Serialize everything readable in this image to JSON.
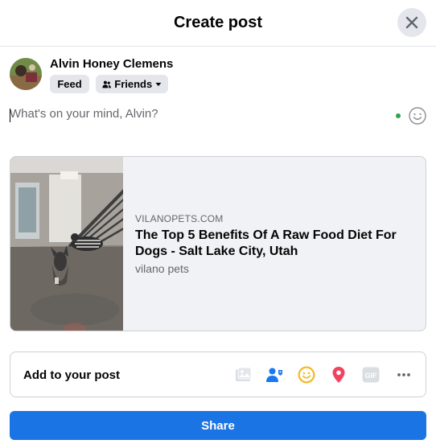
{
  "header": {
    "title": "Create post"
  },
  "user": {
    "name": "Alvin Honey Clemens"
  },
  "audience": {
    "feed_label": "Feed",
    "friends_label": "Friends"
  },
  "composer": {
    "placeholder": "What's on your mind, Alvin?"
  },
  "link_preview": {
    "domain": "VILANOPETS.COM",
    "title": "The Top 5 Benefits Of A Raw Food Diet For Dogs - Salt Lake City, Utah",
    "description": "vilano pets"
  },
  "add_to_post": {
    "label": "Add to your post",
    "icons": [
      "photo-video-icon",
      "tag-people-icon",
      "feeling-activity-icon",
      "check-in-icon",
      "gif-icon",
      "more-icon"
    ]
  },
  "share": {
    "label": "Share"
  },
  "colors": {
    "accent": "#1b74e4",
    "tag_people": "#1877f2",
    "feeling": "#f7b928",
    "check_in": "#f3425f",
    "online_dot": "#31a24c"
  }
}
